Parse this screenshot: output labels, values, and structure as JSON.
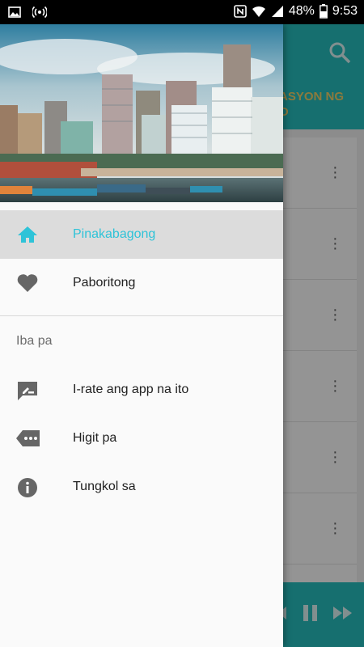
{
  "status_bar": {
    "battery_percent": "48%",
    "time": "9:53",
    "icons": [
      "image-icon",
      "hotspot-icon",
      "nfc-icon",
      "wifi-icon",
      "signal-icon",
      "battery-icon"
    ]
  },
  "app": {
    "toolbar_title": "ASYON NG\nO",
    "accent_color": "#26bfbf",
    "title_color": "#f0d36a",
    "rows": 6
  },
  "drawer": {
    "header_image": "city-waterfront-image",
    "items": [
      {
        "label": "Pinakabagong",
        "icon": "home-icon",
        "active": true
      },
      {
        "label": "Paboritong",
        "icon": "heart-icon",
        "active": false
      }
    ],
    "section_label": "Iba pa",
    "more_items": [
      {
        "label": "I-rate ang app na ito",
        "icon": "rate-review-icon"
      },
      {
        "label": "Higit pa",
        "icon": "more-label-icon"
      },
      {
        "label": "Tungkol sa",
        "icon": "info-icon"
      }
    ],
    "active_color": "#2ec3d8"
  }
}
